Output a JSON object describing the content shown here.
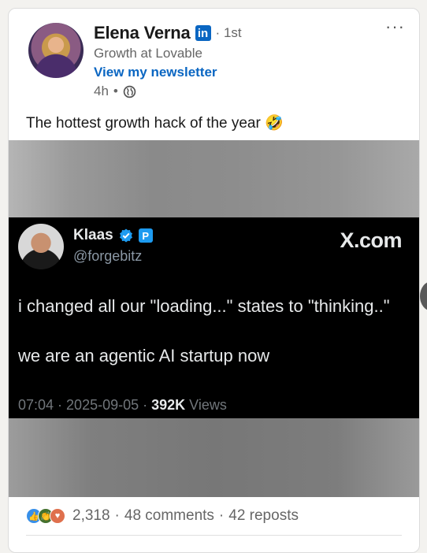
{
  "post": {
    "author": "Elena Verna",
    "degree": "1st",
    "headline": "Growth at Lovable",
    "newsletter_link": "View my newsletter",
    "time": "4h",
    "text": "The hottest growth hack of the year 🤣"
  },
  "tweet": {
    "name": "Klaas",
    "handle": "@forgebitz",
    "source": "X.com",
    "line1": "i changed all our \"loading...\" states to \"thinking..\"",
    "line2": "we are an agentic AI startup now",
    "time": "07:04",
    "date": "2025-09-05",
    "views_count": "392K",
    "views_label": "Views"
  },
  "social": {
    "reactions": "2,318",
    "comments": "48 comments",
    "reposts": "42 reposts"
  },
  "colors": {
    "link": "#0a66c2",
    "tweet_bg": "#000000",
    "verified": "#1d9bf0"
  }
}
